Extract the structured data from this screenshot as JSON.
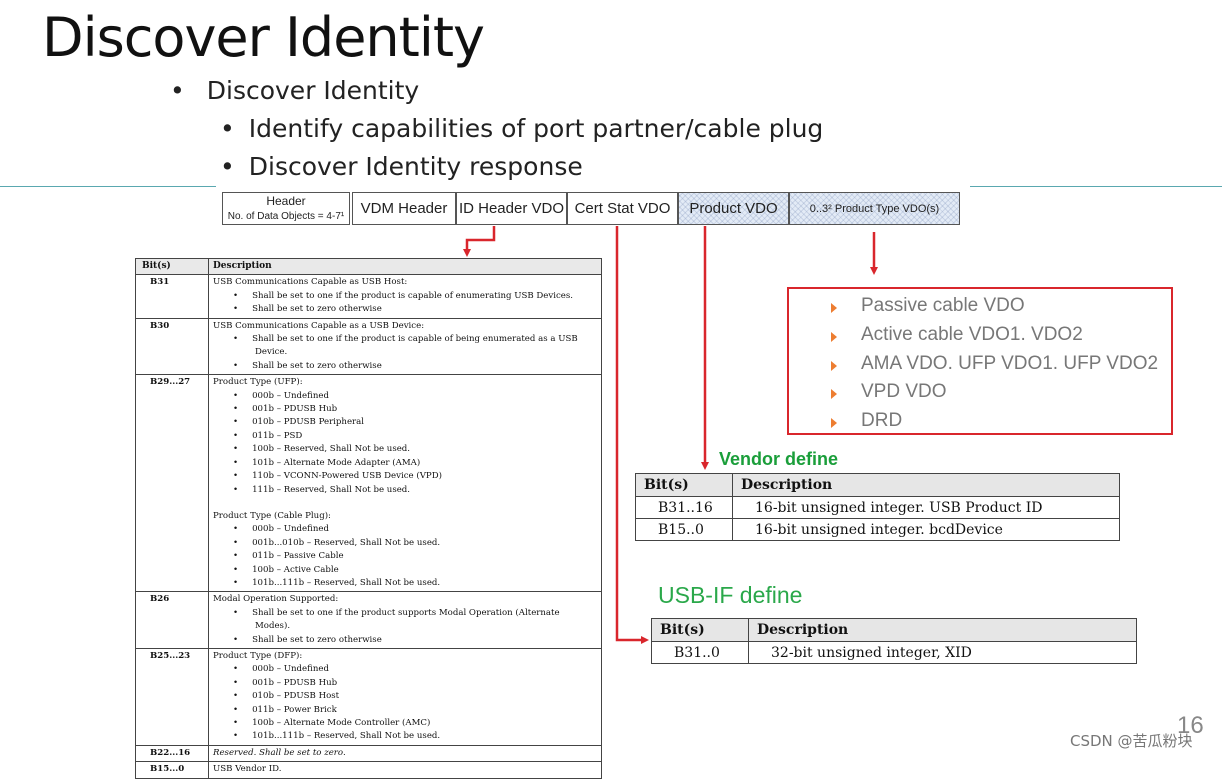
{
  "title": "Discover Identity",
  "bullets": {
    "level1": "Discover Identity",
    "level2": [
      "Identify capabilities of port partner/cable plug",
      "Discover Identity response"
    ]
  },
  "message": {
    "header_label": "Header",
    "header_sub": "No. of Data Objects = 4-7¹",
    "boxes": [
      "VDM Header",
      "ID Header VDO",
      "Cert Stat VDO",
      "Product VDO",
      "0..3² Product Type VDO(s)"
    ]
  },
  "id_header_table": {
    "headers": [
      "Bit(s)",
      "Description"
    ],
    "b31_bit": "B31",
    "b31_title": "USB Communications Capable as USB Host:",
    "b31_items": [
      "Shall be set to one if the product is capable of enumerating USB Devices.",
      "Shall be set to zero otherwise"
    ],
    "b30_bit": "B30",
    "b30_title": "USB Communications Capable as a USB Device:",
    "b30_items": [
      "Shall be set to one if the product is capable of being enumerated as a USB Device.",
      "Shall be set to zero otherwise"
    ],
    "b29_bit": "B29...27",
    "b29_title_ufp": "Product Type (UFP):",
    "b29_items_ufp": [
      "000b – Undefined",
      "001b – PDUSB Hub",
      "010b – PDUSB Peripheral",
      "011b – PSD",
      "100b – Reserved, Shall Not be used.",
      "101b – Alternate Mode Adapter (AMA)",
      "110b – VCONN-Powered USB Device (VPD)",
      "111b – Reserved, Shall Not be used."
    ],
    "b29_title_cable": "Product Type (Cable Plug):",
    "b29_items_cable": [
      "000b – Undefined",
      "001b...010b – Reserved, Shall Not be used.",
      "011b – Passive Cable",
      "100b – Active Cable",
      "101b...111b – Reserved, Shall Not be used."
    ],
    "b26_bit": "B26",
    "b26_title": "Modal Operation Supported:",
    "b26_items": [
      "Shall be set to one if the product supports Modal Operation (Alternate Modes).",
      "Shall be set to zero otherwise"
    ],
    "b25_bit": "B25...23",
    "b25_title": "Product Type (DFP):",
    "b25_items": [
      "000b – Undefined",
      "001b – PDUSB Hub",
      "010b – PDUSB Host",
      "011b – Power Brick",
      "100b – Alternate Mode Controller (AMC)",
      "101b...111b – Reserved, Shall Not be used."
    ],
    "b22_bit": "B22...16",
    "b22_desc": "Reserved. Shall be set to zero.",
    "b15_bit": "B15...0",
    "b15_desc": "USB Vendor ID."
  },
  "product_type_list": [
    "Passive cable VDO",
    "Active cable VDO1. VDO2",
    "AMA VDO. UFP VDO1. UFP VDO2",
    "VPD VDO",
    "DRD"
  ],
  "vendor_define": {
    "label": "Vendor define",
    "headers": [
      "Bit(s)",
      "Description"
    ],
    "rows": [
      [
        "B31..16",
        "16-bit unsigned integer.  USB Product ID"
      ],
      [
        "B15..0",
        "16-bit unsigned integer.  bcdDevice"
      ]
    ]
  },
  "usbif_define": {
    "label": "USB-IF define",
    "headers": [
      "Bit(s)",
      "Description"
    ],
    "rows": [
      [
        "B31..0",
        "32-bit unsigned integer, XID"
      ]
    ]
  },
  "page_number": "16",
  "watermark": "CSDN @苦瓜粉块",
  "colors": {
    "arrow": "#d9262c",
    "vendor_green": "#1a9e3a",
    "usbif_green": "#2aa84a",
    "divider": "#5aa8b0",
    "bullet_marker": "#ed7d31"
  }
}
